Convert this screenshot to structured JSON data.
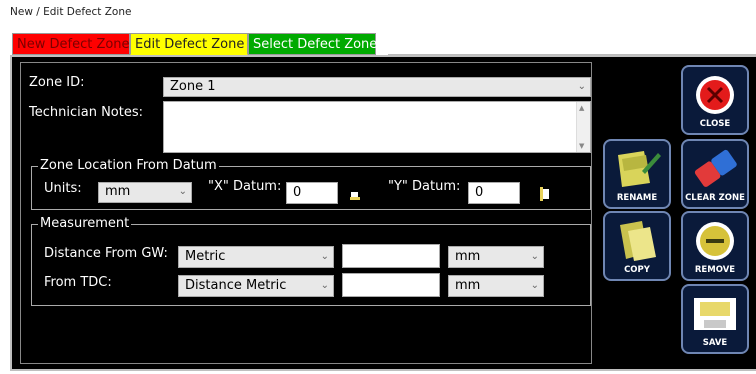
{
  "window": {
    "title": "New / Edit Defect Zone"
  },
  "tabs": [
    {
      "label": "New Defect Zone",
      "color": "#ff0000"
    },
    {
      "label": "Edit Defect Zone",
      "color": "#ffff00",
      "active": true
    },
    {
      "label": "Select Defect Zone",
      "color": "#00aa00"
    }
  ],
  "form": {
    "zone_id_label": "Zone ID:",
    "zone_id_value": "Zone 1",
    "notes_label": "Technician Notes:",
    "notes_value": ""
  },
  "location": {
    "group_title": "Zone Location From Datum",
    "units_label": "Units:",
    "units_value": "mm",
    "x_label": "\"X\" Datum:",
    "x_value": "0",
    "y_label": "\"Y\" Datum:",
    "y_value": "0"
  },
  "measurement": {
    "group_title": "Measurement",
    "gw_label": "Distance From GW:",
    "gw_type": "Metric",
    "gw_value": "",
    "gw_unit": "mm",
    "tdc_label": "From TDC:",
    "tdc_type": "Distance Metric",
    "tdc_value": "",
    "tdc_unit": "mm"
  },
  "buttons": {
    "rename": "RENAME",
    "copy": "COPY",
    "close": "CLOSE",
    "clear_zone": "CLEAR ZONE",
    "remove": "REMOVE",
    "save": "SAVE"
  }
}
